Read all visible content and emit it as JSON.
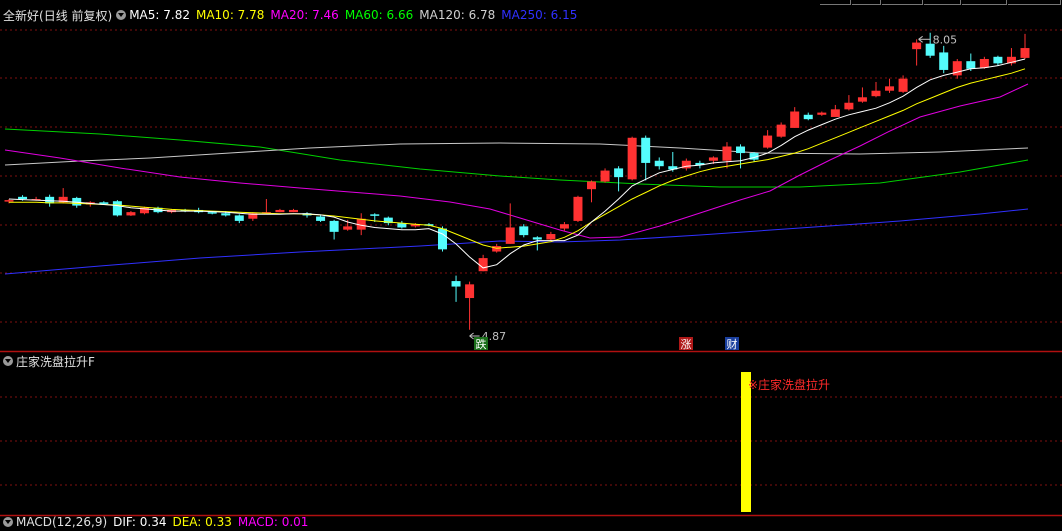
{
  "main_panel": {
    "stock_name": "全新好",
    "period_label": "(日线 前复权)",
    "ma_legend": [
      {
        "label": "MA5: 7.82",
        "color": "#ffffff"
      },
      {
        "label": "MA10: 7.78",
        "color": "#ffff00"
      },
      {
        "label": "MA20: 7.46",
        "color": "#ff00ff"
      },
      {
        "label": "MA60: 6.66",
        "color": "#00ff00"
      },
      {
        "label": "MA120: 6.78",
        "color": "#d0d0d0"
      },
      {
        "label": "MA250: 6.15",
        "color": "#3030ff"
      }
    ],
    "high_label": "8.05",
    "low_label": "4.87",
    "badges": [
      {
        "text": "跌",
        "bg": "#1a6e1a"
      },
      {
        "text": "涨",
        "bg": "#b01818"
      },
      {
        "text": "财",
        "bg": "#1a3f9e"
      }
    ]
  },
  "indicator_panel": {
    "title": "庄家洗盘拉升F",
    "signal_label": "※庄家洗盘拉升",
    "signal_color": "#ffff00"
  },
  "macd_panel": {
    "label": "MACD(12,26,9)",
    "dif": "DIF: 0.34",
    "dea": "DEA: 0.33",
    "macd": "MACD: 0.01"
  },
  "colors": {
    "up": "#ff3232",
    "down": "#54fcfc",
    "grid": "#801010",
    "divider": "#b01010"
  },
  "chart_data": {
    "type": "candlestick",
    "candles": [
      [
        7.23,
        7.24,
        7.18,
        7.26
      ],
      [
        7.3,
        7.26,
        7.23,
        7.33
      ],
      [
        7.24,
        7.26,
        7.23,
        7.3
      ],
      [
        7.3,
        7.18,
        7.12,
        7.34
      ],
      [
        7.2,
        7.3,
        7.18,
        7.46
      ],
      [
        7.28,
        7.14,
        7.1,
        7.3
      ],
      [
        7.16,
        7.2,
        7.12,
        7.22
      ],
      [
        7.2,
        7.17,
        7.15,
        7.22
      ],
      [
        7.22,
        6.96,
        6.94,
        7.24
      ],
      [
        6.96,
        7.02,
        6.95,
        7.04
      ],
      [
        7.0,
        7.1,
        6.98,
        7.12
      ],
      [
        7.1,
        7.02,
        7.0,
        7.12
      ],
      [
        7.02,
        7.06,
        7.0,
        7.08
      ],
      [
        7.06,
        7.04,
        7.02,
        7.08
      ],
      [
        7.06,
        7.02,
        7.0,
        7.1
      ],
      [
        7.02,
        7.0,
        6.98,
        7.04
      ],
      [
        7.0,
        6.96,
        6.94,
        7.04
      ],
      [
        6.96,
        6.86,
        6.82,
        6.98
      ],
      [
        6.9,
        7.0,
        6.86,
        7.02
      ],
      [
        7.02,
        7.02,
        7.0,
        7.26
      ],
      [
        7.02,
        7.06,
        7.02,
        7.08
      ],
      [
        7.02,
        7.06,
        7.02,
        7.08
      ],
      [
        7.0,
        6.96,
        6.92,
        7.02
      ],
      [
        6.94,
        6.86,
        6.84,
        6.96
      ],
      [
        6.86,
        6.66,
        6.52,
        6.88
      ],
      [
        6.7,
        6.76,
        6.68,
        6.88
      ],
      [
        6.7,
        6.9,
        6.6,
        7.0
      ],
      [
        6.98,
        6.96,
        6.84,
        7.0
      ],
      [
        6.92,
        6.82,
        6.78,
        6.94
      ],
      [
        6.82,
        6.74,
        6.72,
        6.86
      ],
      [
        6.76,
        6.8,
        6.74,
        6.82
      ],
      [
        6.8,
        6.78,
        6.76,
        6.82
      ],
      [
        6.72,
        6.34,
        6.3,
        6.76
      ],
      [
        5.76,
        5.66,
        5.38,
        5.86
      ],
      [
        5.45,
        5.7,
        4.87,
        5.75
      ],
      [
        5.94,
        6.18,
        5.94,
        6.24
      ],
      [
        6.3,
        6.4,
        6.28,
        6.44
      ],
      [
        6.44,
        6.74,
        6.44,
        7.18
      ],
      [
        6.76,
        6.6,
        6.56,
        6.8
      ],
      [
        6.56,
        6.52,
        6.32,
        6.58
      ],
      [
        6.52,
        6.62,
        6.5,
        6.66
      ],
      [
        6.72,
        6.8,
        6.68,
        6.84
      ],
      [
        6.86,
        7.3,
        6.84,
        7.32
      ],
      [
        7.44,
        7.58,
        7.2,
        7.6
      ],
      [
        7.58,
        7.78,
        7.56,
        7.82
      ],
      [
        7.82,
        7.66,
        7.4,
        7.86
      ],
      [
        7.62,
        8.38,
        7.6,
        8.4
      ],
      [
        8.38,
        7.92,
        7.6,
        8.42
      ],
      [
        7.96,
        7.86,
        7.8,
        8.02
      ],
      [
        7.86,
        7.8,
        7.76,
        8.12
      ],
      [
        7.82,
        7.96,
        7.78,
        8.0
      ],
      [
        7.92,
        7.88,
        7.82,
        7.96
      ],
      [
        7.96,
        8.02,
        7.9,
        8.04
      ],
      [
        7.96,
        8.22,
        7.82,
        8.3
      ],
      [
        8.22,
        8.1,
        7.82,
        8.26
      ],
      [
        8.1,
        7.98,
        7.94,
        8.12
      ],
      [
        8.2,
        8.42,
        8.18,
        8.52
      ],
      [
        8.4,
        8.62,
        8.38,
        8.66
      ],
      [
        8.56,
        8.86,
        8.56,
        8.94
      ],
      [
        8.8,
        8.72,
        8.7,
        8.84
      ],
      [
        8.8,
        8.84,
        8.78,
        8.86
      ],
      [
        8.76,
        8.9,
        8.76,
        8.98
      ],
      [
        8.9,
        9.02,
        8.88,
        9.16
      ],
      [
        9.04,
        9.12,
        9.02,
        9.3
      ],
      [
        9.14,
        9.24,
        9.12,
        9.4
      ],
      [
        9.24,
        9.32,
        9.2,
        9.46
      ],
      [
        9.22,
        9.46,
        9.2,
        9.52
      ],
      [
        10.0,
        10.12,
        9.7,
        10.18
      ],
      [
        10.1,
        9.88,
        9.84,
        10.3
      ],
      [
        9.94,
        9.62,
        9.56,
        10.06
      ],
      [
        9.52,
        9.78,
        9.46,
        9.82
      ],
      [
        9.78,
        9.64,
        9.6,
        9.92
      ],
      [
        9.66,
        9.82,
        9.64,
        9.86
      ],
      [
        9.86,
        9.74,
        9.7,
        9.88
      ],
      [
        9.74,
        9.86,
        9.7,
        10.02
      ],
      [
        9.84,
        10.02,
        9.82,
        10.28
      ]
    ],
    "ma": {
      "MA5": [
        7.26,
        7.25,
        7.24,
        7.23,
        7.22,
        7.2,
        7.18,
        7.16,
        7.14,
        7.1,
        7.08,
        7.06,
        7.04,
        7.04,
        7.04,
        7.03,
        7.02,
        7.0,
        6.98,
        6.98,
        6.98,
        6.99,
        6.99,
        6.97,
        6.93,
        6.84,
        6.78,
        6.74,
        6.72,
        6.7,
        6.7,
        6.72,
        6.62,
        6.44,
        6.2,
        6.0,
        6.06,
        6.26,
        6.42,
        6.5,
        6.5,
        6.5,
        6.6,
        6.84,
        7.04,
        7.26,
        7.5,
        7.62,
        7.74,
        7.8,
        7.86,
        7.88,
        7.92,
        7.94,
        7.96,
        8.02,
        8.1,
        8.24,
        8.4,
        8.52,
        8.62,
        8.72,
        8.8,
        8.86,
        8.92,
        9.02,
        9.14,
        9.3,
        9.44,
        9.52,
        9.58,
        9.64,
        9.66,
        9.7,
        9.76,
        9.82
      ],
      "MA10": [
        7.2,
        7.2,
        7.2,
        7.19,
        7.19,
        7.18,
        7.17,
        7.16,
        7.15,
        7.13,
        7.11,
        7.09,
        7.07,
        7.06,
        7.05,
        7.04,
        7.03,
        7.02,
        7.01,
        7.0,
        6.99,
        6.99,
        6.98,
        6.97,
        6.95,
        6.92,
        6.89,
        6.86,
        6.84,
        6.82,
        6.8,
        6.78,
        6.72,
        6.62,
        6.52,
        6.42,
        6.36,
        6.38,
        6.4,
        6.44,
        6.48,
        6.56,
        6.68,
        6.84,
        6.98,
        7.12,
        7.26,
        7.38,
        7.5,
        7.6,
        7.68,
        7.76,
        7.82,
        7.86,
        7.9,
        7.94,
        7.98,
        8.04,
        8.1,
        8.18,
        8.28,
        8.38,
        8.48,
        8.58,
        8.68,
        8.78,
        8.88,
        9.0,
        9.1,
        9.2,
        9.3,
        9.38,
        9.44,
        9.5,
        9.56,
        9.64
      ]
    }
  }
}
